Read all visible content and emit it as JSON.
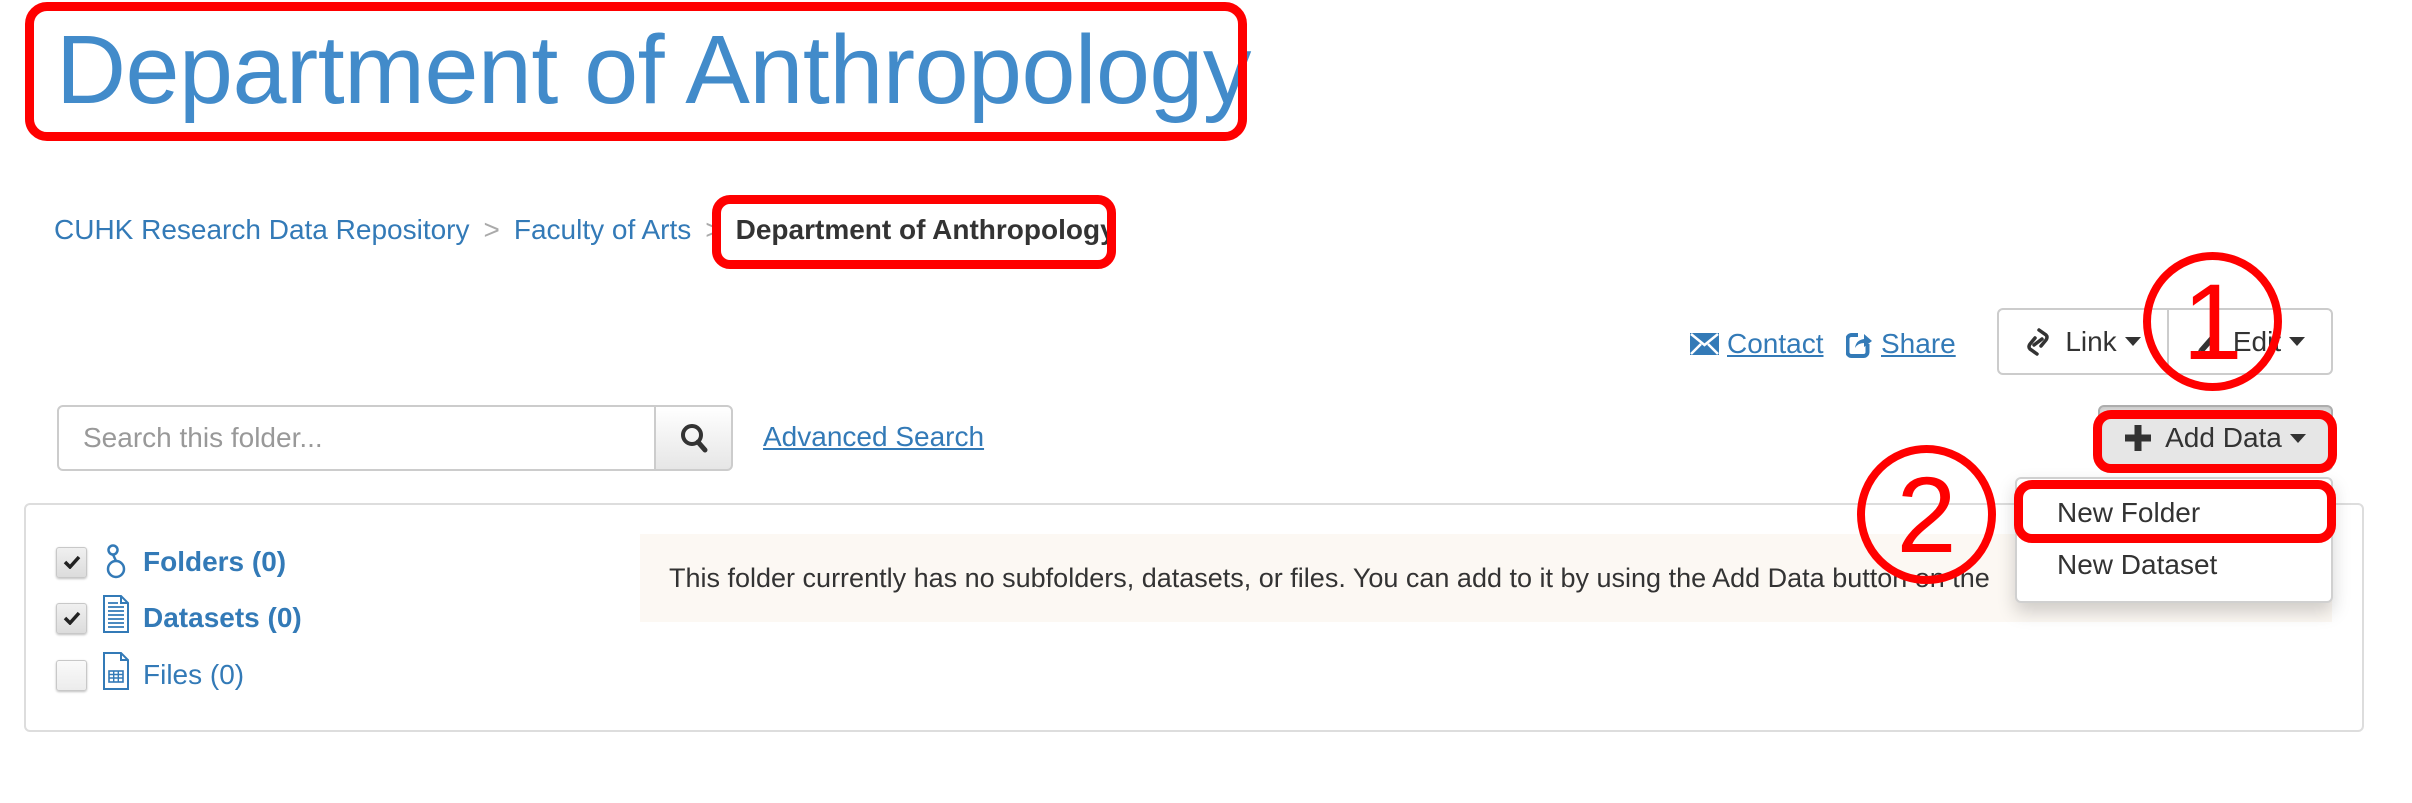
{
  "page": {
    "title": "Department of Anthropology"
  },
  "breadcrumb": {
    "items": [
      "CUHK Research Data Repository",
      "Faculty of Arts"
    ],
    "separator": ">",
    "current": "Department of Anthropology"
  },
  "actions": {
    "contact_label": "Contact",
    "share_label": "Share",
    "link_label": "Link",
    "edit_label": "Edit"
  },
  "search": {
    "placeholder": "Search this folder...",
    "value": "",
    "advanced_label": "Advanced Search"
  },
  "add_data": {
    "label": "Add Data",
    "menu": [
      "New Folder",
      "New Dataset"
    ]
  },
  "facets": [
    {
      "label": "Folders (0)",
      "checked": true,
      "icon": "folder-tree-icon"
    },
    {
      "label": "Datasets (0)",
      "checked": true,
      "icon": "dataset-document-icon"
    },
    {
      "label": "Files (0)",
      "checked": false,
      "icon": "file-table-icon"
    }
  ],
  "message": "This folder currently has no subfolders, datasets, or files. You can add to it by using the Add Data button on the",
  "annotations": {
    "step1": "1",
    "step2": "2",
    "color": "#ff0000"
  },
  "colors": {
    "link": "#337ab7",
    "title": "#428bca",
    "message_bg": "#fcf8f3"
  }
}
